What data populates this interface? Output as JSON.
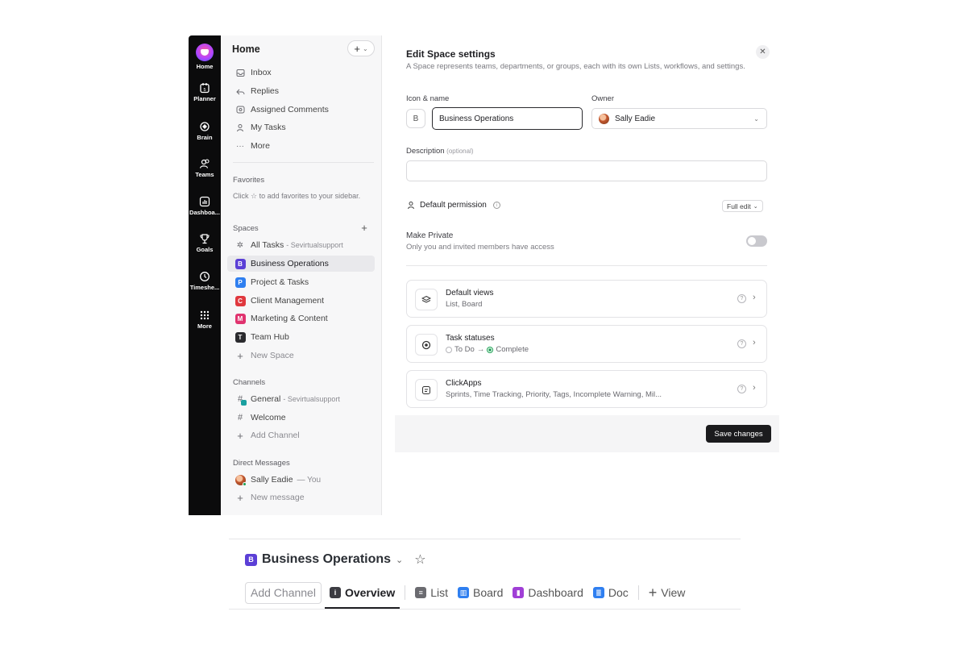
{
  "rail": {
    "items": [
      {
        "label": "Home",
        "icon": "clickup-logo-icon"
      },
      {
        "label": "Planner",
        "icon": "calendar-icon"
      },
      {
        "label": "Brain",
        "icon": "brain-icon"
      },
      {
        "label": "Teams",
        "icon": "teams-icon"
      },
      {
        "label": "Dashboa...",
        "icon": "dashboard-icon"
      },
      {
        "label": "Goals",
        "icon": "trophy-icon"
      },
      {
        "label": "Timeshe...",
        "icon": "clock-icon"
      },
      {
        "label": "More",
        "icon": "grid-icon"
      }
    ],
    "planner_day": "5"
  },
  "sidebar": {
    "title": "Home",
    "plus_button": "+",
    "nav": [
      {
        "label": "Inbox",
        "icon": "inbox-icon"
      },
      {
        "label": "Replies",
        "icon": "reply-icon"
      },
      {
        "label": "Assigned Comments",
        "icon": "comment-icon"
      },
      {
        "label": "My Tasks",
        "icon": "user-task-icon"
      },
      {
        "label": "More",
        "icon": "ellipsis-icon"
      }
    ],
    "favorites_heading": "Favorites",
    "favorites_hint_pre": "Click",
    "favorites_hint_post": "to add favorites to your sidebar.",
    "spaces_heading": "Spaces",
    "all_tasks": {
      "label": "All Tasks",
      "workspace": "- Sevirtualsupport"
    },
    "spaces": [
      {
        "letter": "B",
        "label": "Business Operations",
        "color": "#5b3fd6",
        "active": true
      },
      {
        "letter": "P",
        "label": "Project & Tasks",
        "color": "#2f7ff0",
        "active": false
      },
      {
        "letter": "C",
        "label": "Client Management",
        "color": "#e0383e",
        "active": false
      },
      {
        "letter": "M",
        "label": "Marketing & Content",
        "color": "#e0336f",
        "active": false
      },
      {
        "letter": "T",
        "label": "Team Hub",
        "color": "#2a2a2e",
        "active": false
      }
    ],
    "new_space": "New Space",
    "channels_heading": "Channels",
    "channels": [
      {
        "label": "General",
        "workspace": "- Sevirtualsupport"
      },
      {
        "label": "Welcome",
        "workspace": ""
      }
    ],
    "add_channel": "Add Channel",
    "dm_heading": "Direct Messages",
    "dm": {
      "name": "Sally Eadie",
      "suffix": "— You"
    },
    "new_message": "New message"
  },
  "modal": {
    "title": "Edit Space settings",
    "subtitle": "A Space represents teams, departments, or groups, each with its own Lists, workflows, and settings.",
    "icon_name_label": "Icon & name",
    "icon_letter": "B",
    "name_value": "Business Operations",
    "owner_label": "Owner",
    "owner_value": "Sally Eadie",
    "description_label": "Description",
    "description_optional": "(optional)",
    "description_value": "",
    "permission_label": "Default permission",
    "permission_value": "Full edit",
    "private_title": "Make Private",
    "private_sub": "Only you and invited members have access",
    "private_on": false,
    "cards": [
      {
        "title": "Default views",
        "subtitle": "List, Board",
        "icon": "layers-icon"
      },
      {
        "title": "Task statuses",
        "status_from": "To Do",
        "status_to": "Complete",
        "icon": "target-icon"
      },
      {
        "title": "ClickApps",
        "subtitle": "Sprints, Time Tracking, Priority, Tags, Incomplete Warning, Mil...",
        "icon": "clickapps-icon"
      }
    ],
    "save_label": "Save changes",
    "colors": {
      "todo": "#b5b5ba",
      "complete": "#1aa052"
    }
  },
  "space_header": {
    "letter": "B",
    "title": "Business Operations",
    "add_channel": "Add Channel",
    "tabs": [
      {
        "label": "Overview",
        "icon_color": "#3c3c42",
        "icon_glyph": "i",
        "active": true
      },
      {
        "label": "List",
        "icon_color": "#6b6b70",
        "icon_glyph": "≡",
        "active": false
      },
      {
        "label": "Board",
        "icon_color": "#2f7ff0",
        "icon_glyph": "▥",
        "active": false
      },
      {
        "label": "Dashboard",
        "icon_color": "#a03fd6",
        "icon_glyph": "▮",
        "active": false
      },
      {
        "label": "Doc",
        "icon_color": "#2f7ff0",
        "icon_glyph": "≣",
        "active": false
      }
    ],
    "add_view": "View"
  }
}
